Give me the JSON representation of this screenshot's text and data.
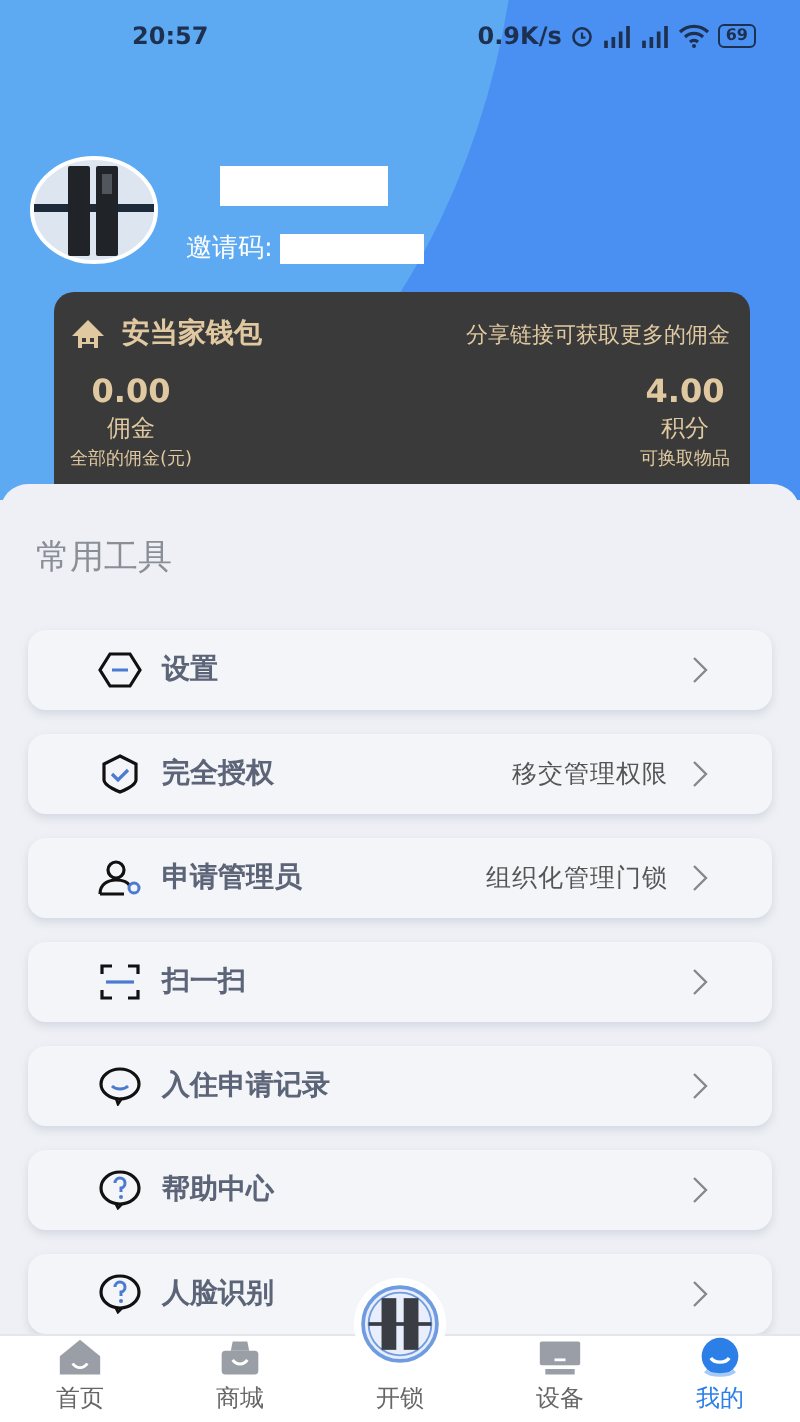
{
  "status_bar": {
    "time": "20:57",
    "speed": "0.9K/s",
    "battery": "69"
  },
  "profile": {
    "invite_label": "邀请码:"
  },
  "wallet": {
    "title": "安当家钱包",
    "hint": "分享链接可获取更多的佣金",
    "stats": [
      {
        "value": "0.00",
        "label": "佣金",
        "note": "全部的佣金(元)"
      },
      {
        "value": "4.00",
        "label": "积分",
        "note": "可换取物品"
      }
    ]
  },
  "section_title": "常用工具",
  "menu": [
    {
      "kind": "settings",
      "label": "设置"
    },
    {
      "kind": "shield",
      "label": "完全授权",
      "detail": "移交管理权限"
    },
    {
      "kind": "admin",
      "label": "申请管理员",
      "detail": "组织化管理门锁"
    },
    {
      "kind": "scan",
      "label": "扫一扫"
    },
    {
      "kind": "chat",
      "label": "入住申请记录"
    },
    {
      "kind": "help",
      "label": "帮助中心"
    },
    {
      "kind": "help",
      "label": "人脸识别"
    }
  ],
  "tab_bar": [
    {
      "kind": "home",
      "label": "首页",
      "selected": false
    },
    {
      "kind": "shop",
      "label": "商城",
      "selected": false
    },
    {
      "kind": "unlock",
      "label": "开锁",
      "selected": false
    },
    {
      "kind": "device",
      "label": "设备",
      "selected": false
    },
    {
      "kind": "mine",
      "label": "我的",
      "selected": true
    }
  ]
}
